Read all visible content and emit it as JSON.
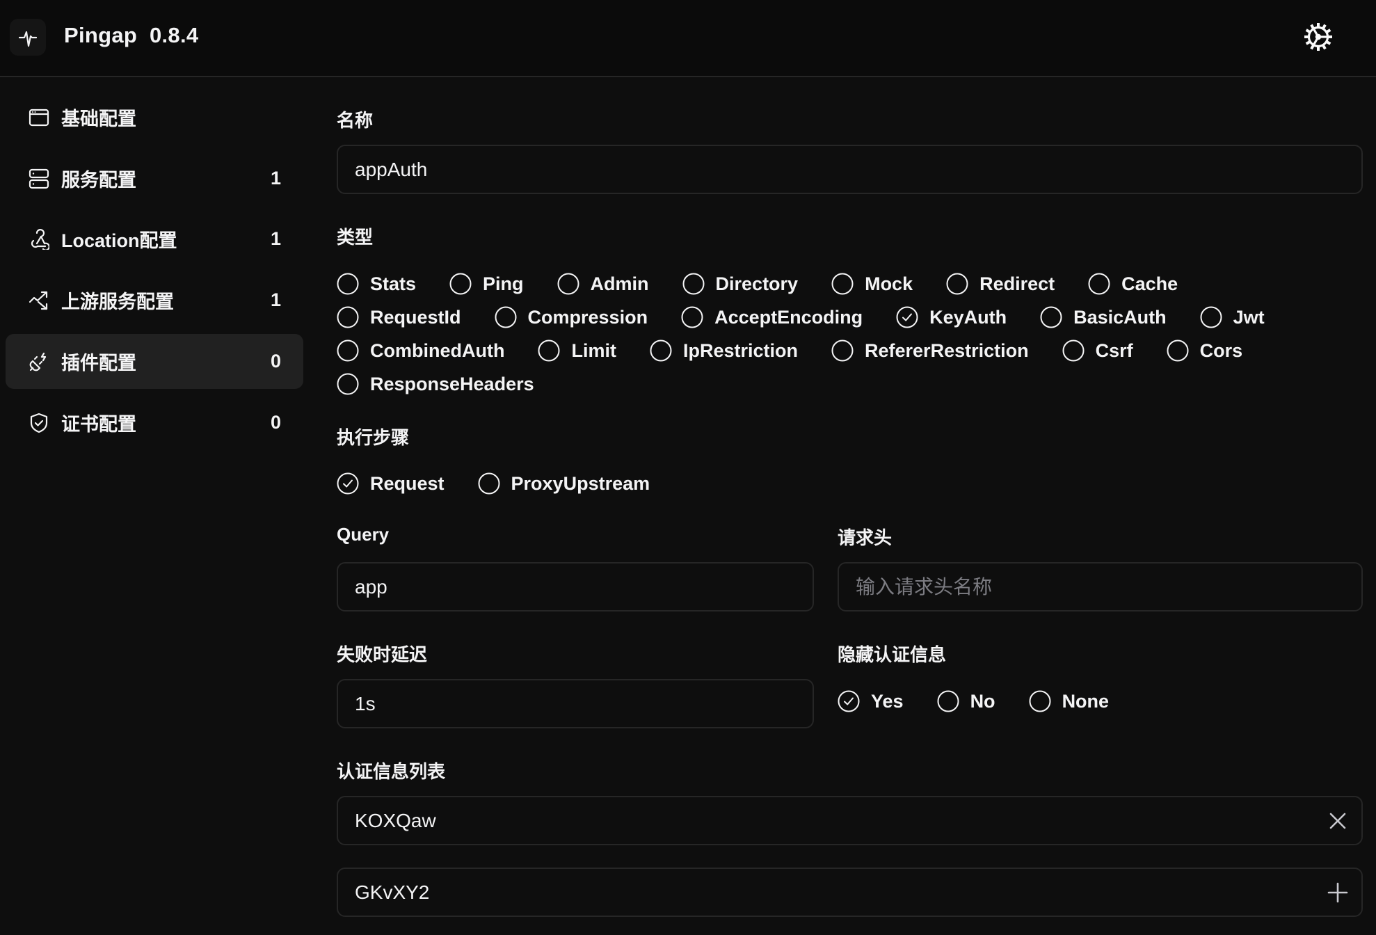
{
  "header": {
    "app_name": "Pingap",
    "version": "0.8.4",
    "logo_icon": "pulse-icon",
    "settings_icon": "gear-icon"
  },
  "sidebar": {
    "items": [
      {
        "label": "基础配置",
        "count": "",
        "icon": "browser-window-icon",
        "active": false
      },
      {
        "label": "服务配置",
        "count": "1",
        "icon": "server-icon",
        "active": false
      },
      {
        "label": "Location配置",
        "count": "1",
        "icon": "webhook-icon",
        "active": false
      },
      {
        "label": "上游服务配置",
        "count": "1",
        "icon": "route-arrows-icon",
        "active": false
      },
      {
        "label": "插件配置",
        "count": "0",
        "icon": "plug-zap-icon",
        "active": true
      },
      {
        "label": "证书配置",
        "count": "0",
        "icon": "shield-check-icon",
        "active": false
      }
    ]
  },
  "form": {
    "name": {
      "label": "名称",
      "value": "appAuth"
    },
    "category": {
      "label": "类型",
      "selected": "KeyAuth",
      "rows": [
        [
          "Stats",
          "Ping",
          "Admin",
          "Directory",
          "Mock",
          "Redirect",
          "Cache"
        ],
        [
          "RequestId",
          "Compression",
          "AcceptEncoding",
          "KeyAuth",
          "BasicAuth",
          "Jwt"
        ],
        [
          "CombinedAuth",
          "Limit",
          "IpRestriction",
          "RefererRestriction",
          "Csrf",
          "Cors"
        ],
        [
          "ResponseHeaders"
        ]
      ]
    },
    "step": {
      "label": "执行步骤",
      "selected": "Request",
      "options": [
        "Request",
        "ProxyUpstream"
      ]
    },
    "query": {
      "label": "Query",
      "value": "app"
    },
    "header": {
      "label": "请求头",
      "value": "",
      "placeholder": "输入请求头名称"
    },
    "delay": {
      "label": "失败时延迟",
      "value": "1s"
    },
    "hide_credentials": {
      "label": "隐藏认证信息",
      "selected": "Yes",
      "options": [
        "Yes",
        "No",
        "None"
      ]
    },
    "keys": {
      "label": "认证信息列表",
      "items": [
        {
          "value": "KOXQaw",
          "action_icon": "close-icon"
        },
        {
          "value": "GKvXY2",
          "action_icon": "plus-icon"
        }
      ]
    }
  }
}
